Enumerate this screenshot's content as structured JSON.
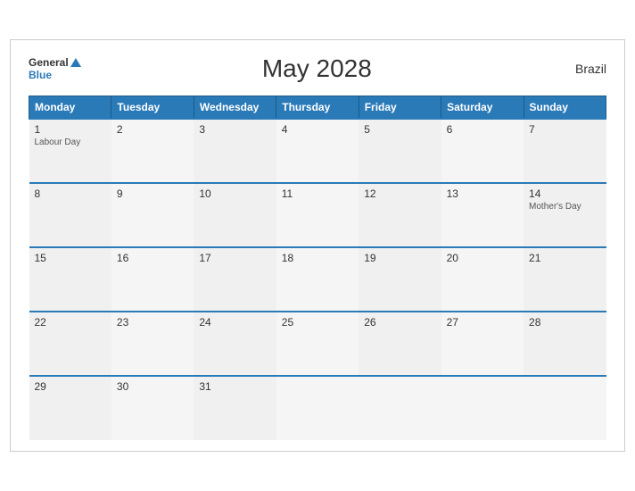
{
  "header": {
    "title": "May 2028",
    "country": "Brazil",
    "logo_general": "General",
    "logo_blue": "Blue"
  },
  "days_of_week": [
    "Monday",
    "Tuesday",
    "Wednesday",
    "Thursday",
    "Friday",
    "Saturday",
    "Sunday"
  ],
  "weeks": [
    [
      {
        "day": "1",
        "event": "Labour Day"
      },
      {
        "day": "2",
        "event": ""
      },
      {
        "day": "3",
        "event": ""
      },
      {
        "day": "4",
        "event": ""
      },
      {
        "day": "5",
        "event": ""
      },
      {
        "day": "6",
        "event": ""
      },
      {
        "day": "7",
        "event": ""
      }
    ],
    [
      {
        "day": "8",
        "event": ""
      },
      {
        "day": "9",
        "event": ""
      },
      {
        "day": "10",
        "event": ""
      },
      {
        "day": "11",
        "event": ""
      },
      {
        "day": "12",
        "event": ""
      },
      {
        "day": "13",
        "event": ""
      },
      {
        "day": "14",
        "event": "Mother's Day"
      }
    ],
    [
      {
        "day": "15",
        "event": ""
      },
      {
        "day": "16",
        "event": ""
      },
      {
        "day": "17",
        "event": ""
      },
      {
        "day": "18",
        "event": ""
      },
      {
        "day": "19",
        "event": ""
      },
      {
        "day": "20",
        "event": ""
      },
      {
        "day": "21",
        "event": ""
      }
    ],
    [
      {
        "day": "22",
        "event": ""
      },
      {
        "day": "23",
        "event": ""
      },
      {
        "day": "24",
        "event": ""
      },
      {
        "day": "25",
        "event": ""
      },
      {
        "day": "26",
        "event": ""
      },
      {
        "day": "27",
        "event": ""
      },
      {
        "day": "28",
        "event": ""
      }
    ],
    [
      {
        "day": "29",
        "event": ""
      },
      {
        "day": "30",
        "event": ""
      },
      {
        "day": "31",
        "event": ""
      },
      {
        "day": "",
        "event": ""
      },
      {
        "day": "",
        "event": ""
      },
      {
        "day": "",
        "event": ""
      },
      {
        "day": "",
        "event": ""
      }
    ]
  ]
}
